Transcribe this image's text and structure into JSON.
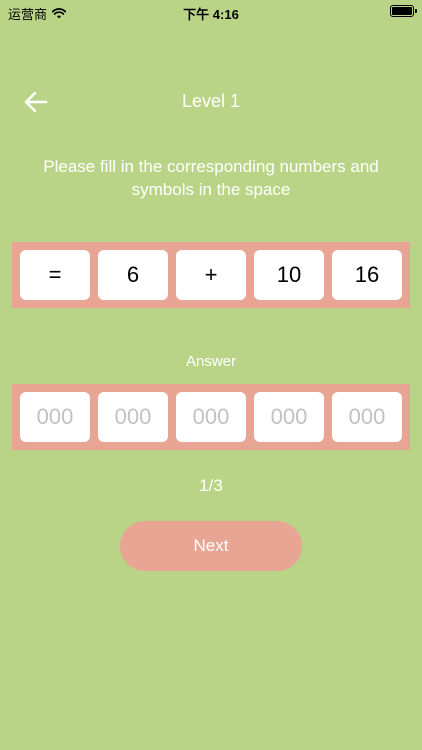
{
  "status_bar": {
    "carrier": "运营商",
    "time": "下午 4:16"
  },
  "header": {
    "title": "Level 1",
    "back_icon": "arrow-left-icon"
  },
  "instruction": "Please fill in the corresponding numbers and symbols in the space",
  "puzzle": {
    "cells": [
      "=",
      "6",
      "+",
      "10",
      "16"
    ]
  },
  "answer": {
    "label": "Answer",
    "fields": [
      {
        "value": "",
        "placeholder": "000"
      },
      {
        "value": "",
        "placeholder": "000"
      },
      {
        "value": "",
        "placeholder": "000"
      },
      {
        "value": "",
        "placeholder": "000"
      },
      {
        "value": "",
        "placeholder": "000"
      }
    ]
  },
  "progress": "1/3",
  "next_button": {
    "label": "Next"
  },
  "colors": {
    "background": "#bad487",
    "accent": "#e8a594",
    "cell": "#ffffff",
    "placeholder": "#c2c2c2"
  }
}
